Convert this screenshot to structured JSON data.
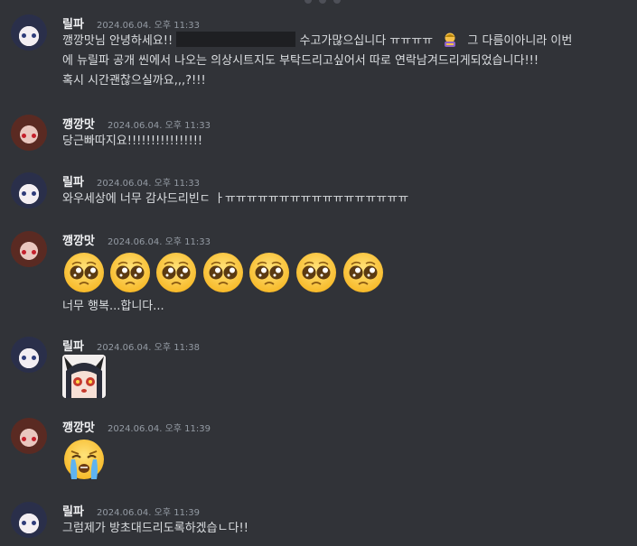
{
  "messages": [
    {
      "author": "릴파",
      "time": "2024.06.04. 오후 11:33",
      "line1_a": "깽깡맛님 안녕하세요!!",
      "line1_b": "수고가많으십니다 ㅠㅠㅠㅠ",
      "line1_c": "그 다름이아니라 이번",
      "line2": "에 뉴릴파 공개 씬에서 나오는 의상시트지도 부탁드리고싶어서 따로 연락남겨드리게되었습니다!!!",
      "line3": "혹시 시간괜찮으실까요,,,?!!!"
    },
    {
      "author": "깽깡맛",
      "time": "2024.06.04. 오후 11:33",
      "text": "당근빠따지요!!!!!!!!!!!!!!!!"
    },
    {
      "author": "릴파",
      "time": "2024.06.04. 오후 11:33",
      "text": "와우세상에 너무 감사드리빈ㄷ ㅏㅠㅠㅠㅠㅠㅠㅠㅠㅠㅠㅠㅠㅠㅠㅠㅠㅠ"
    },
    {
      "author": "깽깡맛",
      "time": "2024.06.04. 오후 11:33",
      "text": "너무 행복...합니다..."
    },
    {
      "author": "릴파",
      "time": "2024.06.04. 오후 11:38"
    },
    {
      "author": "깽깡맛",
      "time": "2024.06.04. 오후 11:39"
    },
    {
      "author": "릴파",
      "time": "2024.06.04. 오후 11:39",
      "text": "그럼제가 방초대드리도록하겠습ㄴ다!!"
    }
  ],
  "icons": {
    "inline_emoji": "person-bowing-emoji",
    "pleading": "pleading-face-emoji",
    "crying": "loudly-crying-face-emoji",
    "sticker": "anime-sticker"
  },
  "colors": {
    "background": "#313338",
    "username": "#f2f3f5",
    "timestamp": "#949ba4",
    "text": "#dbdee1",
    "redaction": "#1e1f22"
  }
}
